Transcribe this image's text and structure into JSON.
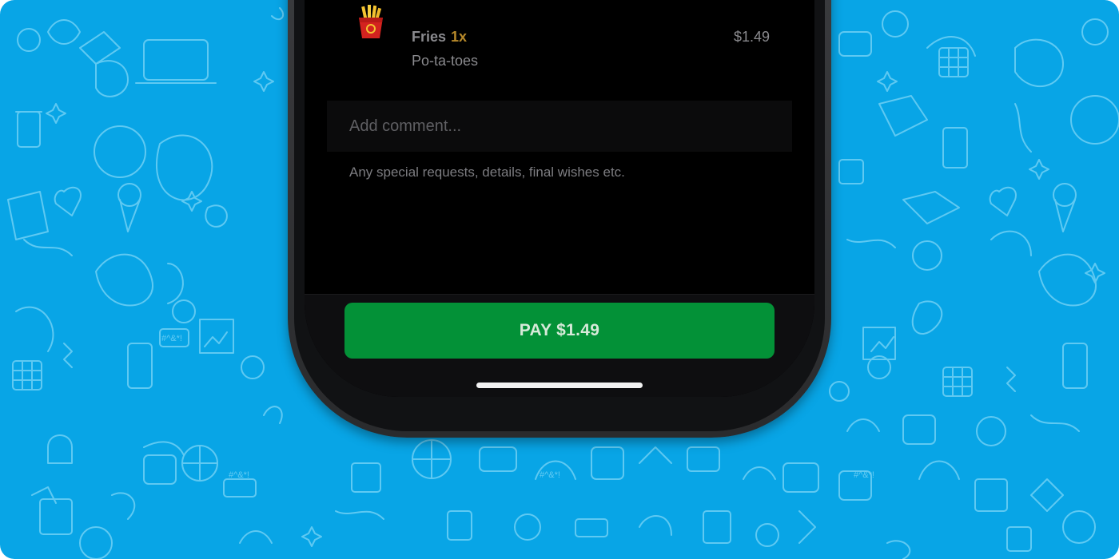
{
  "order": {
    "item": {
      "name": "Fries",
      "quantity": "1x",
      "description": "Po-ta-toes",
      "price": "$1.49",
      "icon": "fries-icon"
    },
    "comment": {
      "placeholder": "Add comment...",
      "hint": "Any special requests, details, final wishes etc."
    },
    "pay_button": "PAY $1.49"
  },
  "colors": {
    "background": "#08a5e6",
    "doodle_line": "#6fd0f5",
    "pay_button": "#039137",
    "quantity": "#b7892a"
  },
  "background_text": {
    "bubble": "#^&*!"
  }
}
